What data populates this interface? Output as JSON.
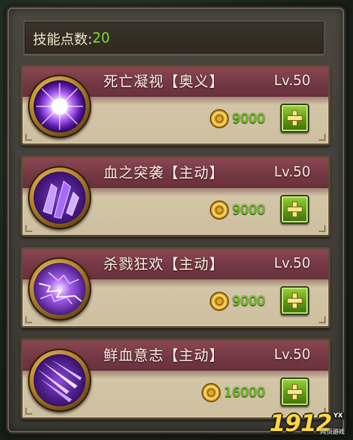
{
  "header": {
    "label": "技能点数:",
    "value": "20"
  },
  "skills": [
    {
      "name": "死亡凝视【奥义】",
      "level": "Lv.50",
      "cost": "9000",
      "icon": "death-gaze-icon",
      "glow": "#ffffff"
    },
    {
      "name": "血之突袭【主动】",
      "level": "Lv.50",
      "cost": "9000",
      "icon": "crystal-shards-icon",
      "glow": "#c08cff"
    },
    {
      "name": "杀戮狂欢【主动】",
      "level": "Lv.50",
      "cost": "9000",
      "icon": "lightning-orb-icon",
      "glow": "#e0c0ff"
    },
    {
      "name": "鲜血意志【主动】",
      "level": "Lv.50",
      "cost": "16000",
      "icon": "slash-strikes-icon",
      "glow": "#b080ff"
    }
  ],
  "watermark": {
    "digits": "1912",
    "tag": "YX",
    "sub": "网页游戏"
  },
  "colors": {
    "accent_green": "#6cc51e",
    "band": "#7a3d47",
    "parchment": "#d3c6a6"
  }
}
